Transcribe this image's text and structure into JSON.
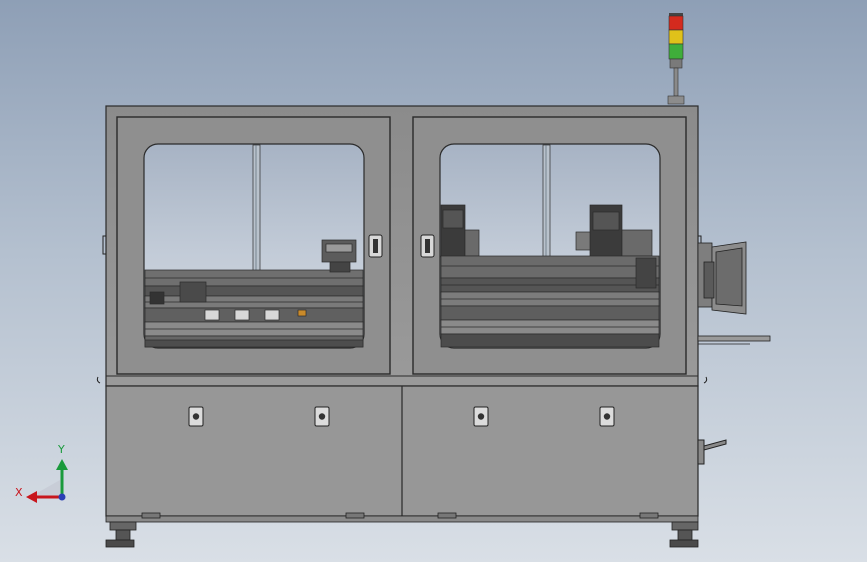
{
  "triad": {
    "x_label": "X",
    "y_label": "Y",
    "colors": {
      "x": "#c8161d",
      "y": "#1a9a3c",
      "z": "#2b3fb5"
    }
  },
  "signal_tower": {
    "lamp_colors": [
      "#d42a1e",
      "#e0c21a",
      "#3fae3a"
    ]
  },
  "machine": {
    "upper_doors": 2,
    "lower_panels": 2,
    "locks_per_lower_panel": 2
  }
}
